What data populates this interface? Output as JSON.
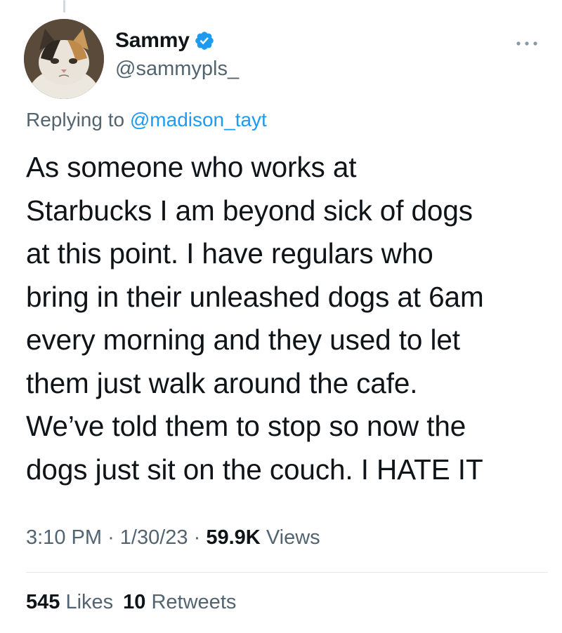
{
  "tweet": {
    "author": {
      "display_name": "Sammy",
      "handle": "@sammypls_",
      "verified": true,
      "avatar_icon": "kitten-avatar"
    },
    "more_icon": "ellipsis-icon",
    "replying_prefix": "Replying to",
    "replying_to": "@madison_tayt",
    "text_lines": [
      "As someone who works at",
      "Starbucks I am beyond sick of dogs",
      "at this point. I have regulars who",
      "bring in their unleashed dogs at 6am",
      "every morning and they used to let",
      "them just walk around the cafe.",
      "We’ve told them to stop so now the",
      "dogs just sit on the couch. I HATE IT"
    ],
    "time": "3:10 PM",
    "date": "1/30/23",
    "separator": "·",
    "views_count": "59.9K",
    "views_label": "Views",
    "likes_count": "545",
    "likes_label": "Likes",
    "retweets_count": "10",
    "retweets_label": "Retweets"
  },
  "colors": {
    "accent": "#1d9bf0",
    "text_primary": "#0f1419",
    "text_secondary": "#536471",
    "divider": "#e1e8ed"
  }
}
